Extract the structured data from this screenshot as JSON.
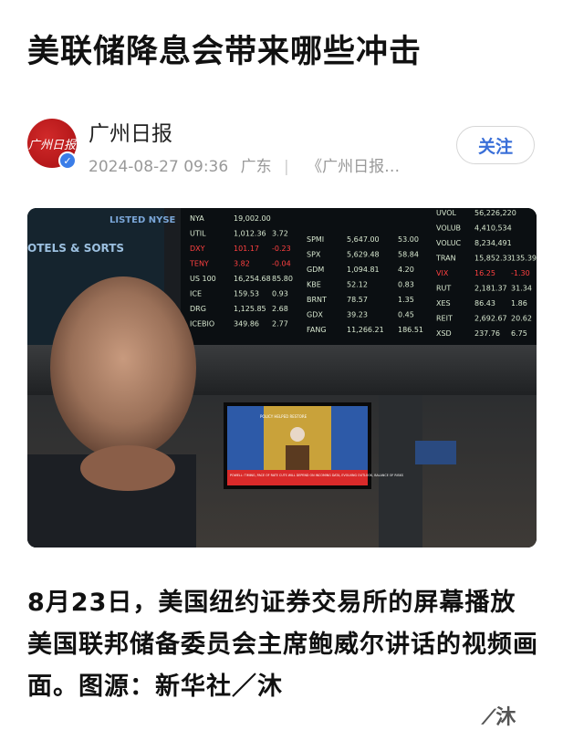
{
  "article": {
    "title": "美联储降息会带来哪些冲击",
    "caption": "8月23日，美国纽约证券交易所的屏幕播放美国联邦储备委员会主席鲍威尔讲话的视频画面。图源：新华社／沐"
  },
  "author": {
    "avatar_text": "广州日报",
    "verified_icon": "check-icon",
    "name": "广州日报",
    "date": "2024-08-27 09:36",
    "location": "广东",
    "source": "《广州日报…"
  },
  "follow": {
    "label": "关注"
  },
  "photo": {
    "exchange_sign": "LISTED NYSE",
    "side_sign": "OTELS & SORTS",
    "ticker_left": [
      {
        "sym": "NYA",
        "price": "19,002.00",
        "chg": ""
      },
      {
        "sym": "UTIL",
        "price": "1,012.36",
        "chg": "3.72"
      },
      {
        "sym": "DXY",
        "price": "101.17",
        "chg": "-0.23"
      },
      {
        "sym": "TENY",
        "price": "3.82",
        "chg": "-0.04"
      },
      {
        "sym": "US 100",
        "price": "16,254.68",
        "chg": "85.80"
      },
      {
        "sym": "ICE",
        "price": "159.53",
        "chg": "0.93"
      },
      {
        "sym": "DRG",
        "price": "1,125.85",
        "chg": "2.68"
      },
      {
        "sym": "ICEBIO",
        "price": "349.86",
        "chg": "2.77"
      }
    ],
    "ticker_mid": [
      {
        "sym": "SPMI",
        "price": "5,647.00",
        "chg": "53.00"
      },
      {
        "sym": "SPX",
        "price": "5,629.48",
        "chg": "58.84"
      },
      {
        "sym": "GDM",
        "price": "1,094.81",
        "chg": "4.20"
      },
      {
        "sym": "KBE",
        "price": "52.12",
        "chg": "0.83"
      },
      {
        "sym": "BRNT",
        "price": "78.57",
        "chg": "1.35"
      },
      {
        "sym": "GDX",
        "price": "39.23",
        "chg": "0.45"
      },
      {
        "sym": "FANG",
        "price": "11,266.21",
        "chg": "186.51"
      }
    ],
    "ticker_right": [
      {
        "sym": "UVOL",
        "price": "56,226,220",
        "chg": ""
      },
      {
        "sym": "VOLUB",
        "price": "4,410,534",
        "chg": ""
      },
      {
        "sym": "VOLUC",
        "price": "8,234,491",
        "chg": ""
      },
      {
        "sym": "TRAN",
        "price": "15,852.33",
        "chg": "135.39"
      },
      {
        "sym": "VIX",
        "price": "16.25",
        "chg": "-1.30"
      },
      {
        "sym": "RUT",
        "price": "2,181.37",
        "chg": "31.34"
      },
      {
        "sym": "XES",
        "price": "86.43",
        "chg": "1.86"
      },
      {
        "sym": "REIT",
        "price": "2,692.67",
        "chg": "20.62"
      },
      {
        "sym": "XSD",
        "price": "237.76",
        "chg": "6.75"
      }
    ],
    "tv_banner": "POWELL: TIMING, PACE OF RATE CUTS WILL DEPEND ON INCOMING DATA, EVOLVING OUTLOOK, BALANCE OF RISKS",
    "tv_podium": "POLICY HELPED RESTORE",
    "colors": {
      "up": "#d8e8d0",
      "down": "#ff4040",
      "board": "#0b0f12"
    }
  },
  "watermark": "⟋沐"
}
